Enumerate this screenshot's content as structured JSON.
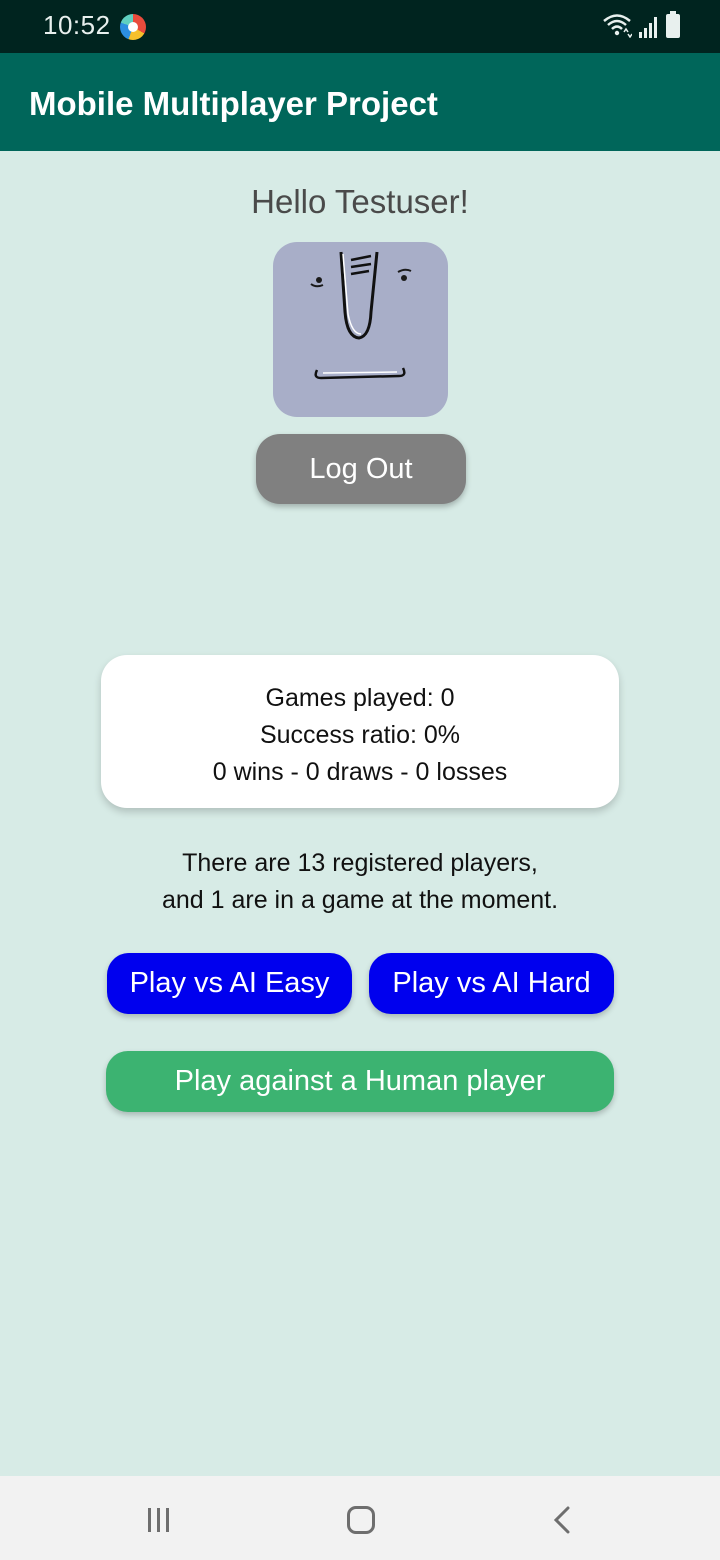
{
  "status_bar": {
    "time": "10:52"
  },
  "app_bar": {
    "title": "Mobile Multiplayer Project"
  },
  "profile": {
    "greeting": "Hello Testuser!",
    "logout_label": "Log Out"
  },
  "stats": {
    "games_played": "Games played: 0",
    "success_ratio": "Success ratio: 0%",
    "record": "0 wins - 0 draws - 0 losses"
  },
  "players": {
    "line1": "There are 13 registered players,",
    "line2": "and 1 are in a game at the moment."
  },
  "actions": {
    "ai_easy_label": "Play vs AI Easy",
    "ai_hard_label": "Play vs AI Hard",
    "human_label": "Play against a Human player"
  },
  "colors": {
    "status_bar": "#00241f",
    "app_bar": "#00665a",
    "background": "#d7ebe6",
    "ai_button": "#0000ee",
    "human_button": "#3cb371",
    "logout_button": "#808080"
  },
  "icons": {
    "status_app": "app-notification-icon",
    "wifi": "wifi-icon",
    "signal": "signal-icon",
    "battery": "battery-icon",
    "nav_recents": "recents-icon",
    "nav_home": "home-icon",
    "nav_back": "back-icon"
  }
}
